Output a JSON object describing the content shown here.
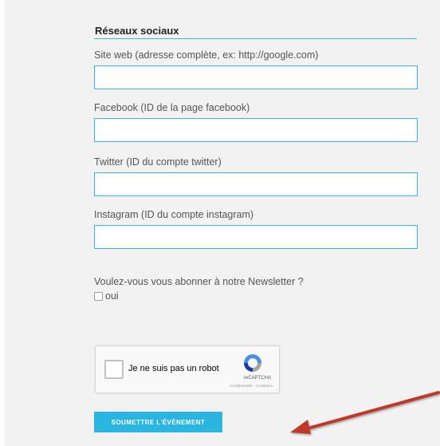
{
  "section": {
    "title": "Réseaux sociaux"
  },
  "fields": [
    {
      "label": "Site web (adresse complète, ex: http://google.com)",
      "value": "",
      "placeholder": ""
    },
    {
      "label": "Facebook (ID de la page facebook)",
      "value": "",
      "placeholder": ""
    },
    {
      "label": "Twitter (ID du compte twitter)",
      "value": "",
      "placeholder": ""
    },
    {
      "label": "Instagram (ID du compte instagram)",
      "value": "",
      "placeholder": ""
    }
  ],
  "newsletter": {
    "question": "Voulez-vous vous abonner à notre Newsletter ?",
    "option_label": "oui",
    "checked": false
  },
  "recaptcha": {
    "label": "Je ne suis pas un robot",
    "brand": "reCAPTCHA",
    "terms": "Confidentialité - Conditions",
    "checked": false
  },
  "submit": {
    "label": "SOUMETTRE L'ÉVÈNEMENT"
  },
  "colors": {
    "accent": "#2ab4e0",
    "border": "#3bb5d8",
    "arrow": "#c0392b",
    "background": "#f2f2f2"
  },
  "annotation": {
    "icon": "red-arrow-icon"
  }
}
